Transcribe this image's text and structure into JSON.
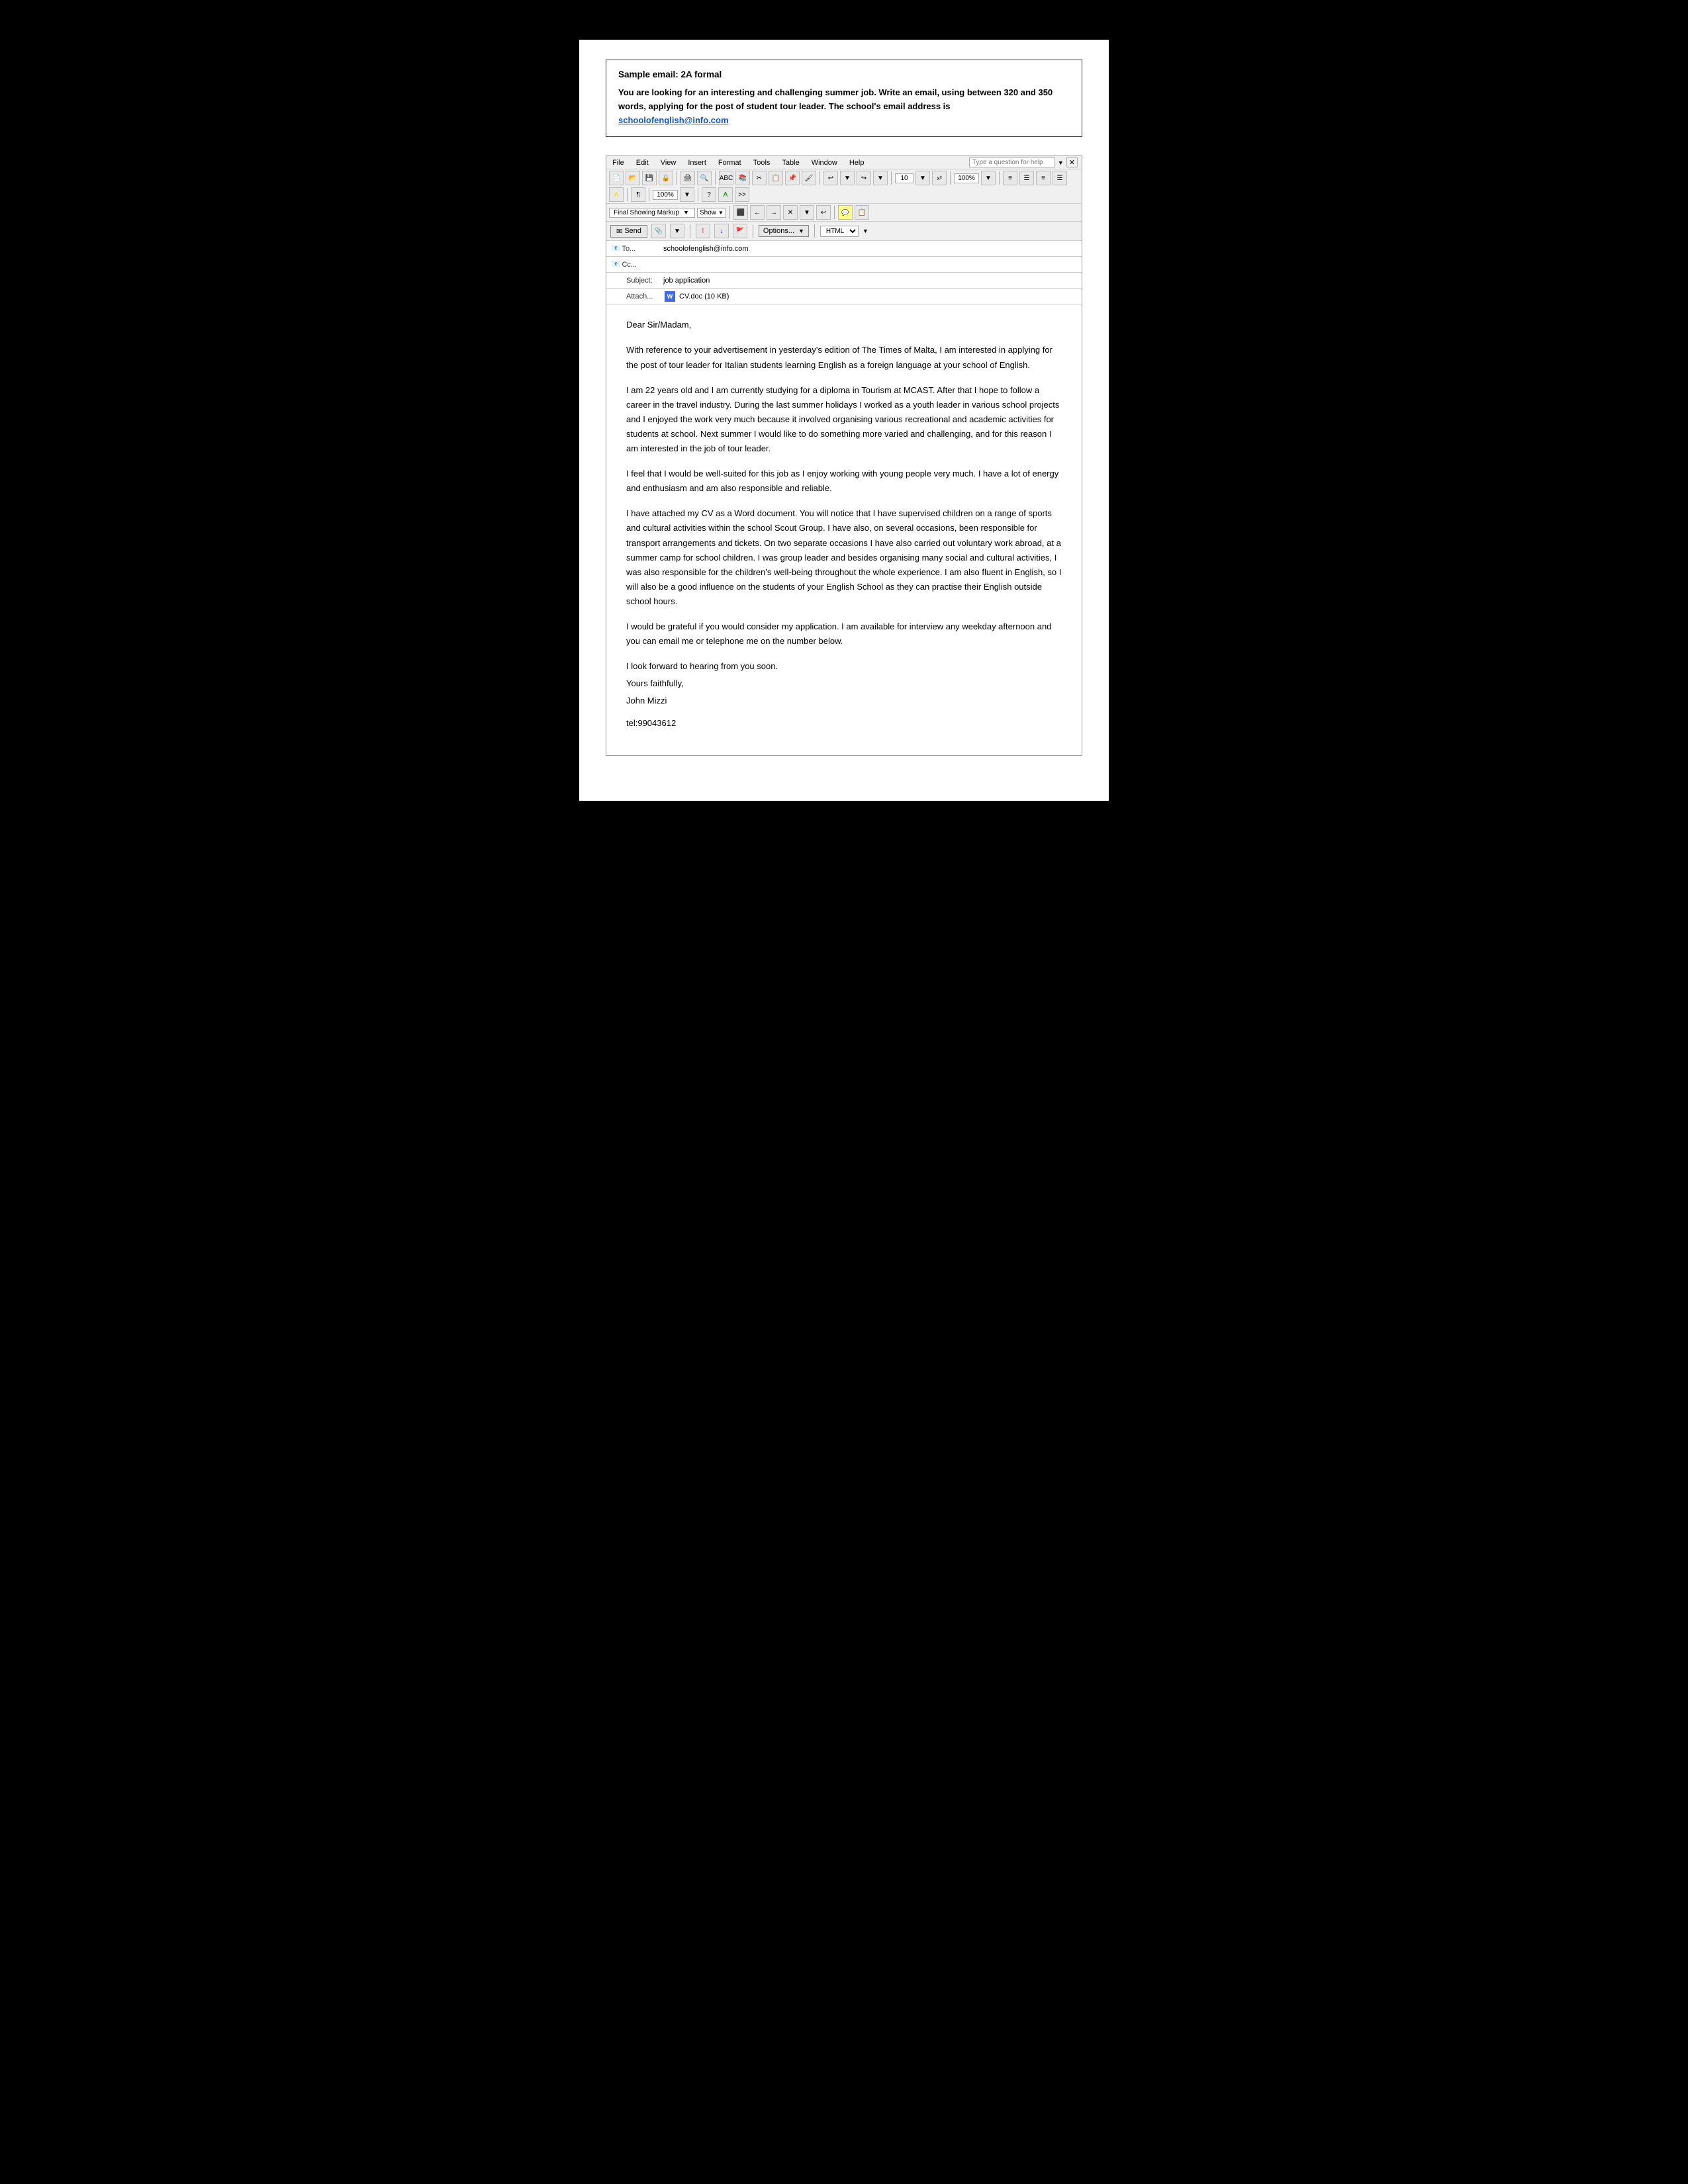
{
  "sample_box": {
    "title": "Sample email: 2A formal",
    "prompt": "You are looking for an interesting and challenging summer job.  Write an email, using between 320 and 350 words, applying for the post of student tour leader.  The school's email address is",
    "email_link": "schoolofenglish@info.com",
    "email_href": "mailto:schoolofenglish@info.com"
  },
  "email_client": {
    "menu": {
      "file": "File",
      "edit": "Edit",
      "view": "View",
      "insert": "Insert",
      "format": "Format",
      "tools": "Tools",
      "table": "Table",
      "window": "Window",
      "help": "Help"
    },
    "help_placeholder": "Type a question for help",
    "toolbar1": {
      "font_size": "10",
      "zoom": "100%",
      "zoom2": "100%"
    },
    "markup_dropdown": "Final Showing Markup",
    "show_dropdown": "Show",
    "send_label": "Send",
    "options_label": "Options...",
    "format_label": "HTML",
    "fields": {
      "to_label": "To...",
      "to_value": "schoolofenglish@info.com",
      "cc_label": "Cc...",
      "cc_value": "",
      "subject_label": "Subject:",
      "subject_value": "job application",
      "attach_label": "Attach...",
      "attach_file": "CV.doc (10 KB)"
    }
  },
  "email_body": {
    "salutation": "Dear Sir/Madam,",
    "para1": "With reference to your advertisement in yesterday's edition of The Times of Malta, I am interested in applying for the post of tour leader for Italian students learning English as a foreign language at your school of English.",
    "para2": "I am 22 years old and I am currently studying for a diploma in Tourism at  MCAST. After that I hope to follow a career in the travel industry. During the last summer holidays I worked as a youth leader in various school projects and I enjoyed the work very much because it involved organising various recreational and academic activities for students at school. Next summer I would like to do something more varied and challenging, and for this reason I am interested in the job of tour leader.",
    "para3": "I feel that I would be well-suited for this job as I enjoy working with young people very much. I have a lot of energy and enthusiasm and am also responsible and reliable.",
    "para4": "I have attached my CV as a Word document. You will notice that I have supervised children on a range of sports and cultural activities within the school Scout Group. I have also, on several occasions, been responsible for transport arrangements and tickets.  On two separate occasions I have also carried out voluntary work abroad, at a summer camp for school children.  I was group leader and besides organising many social and cultural activities, I was also responsible for the children’s well-being throughout the whole experience.  I am also fluent in English, so I will also be a good influence on the students of your English School as they can practise their English outside school hours.",
    "para5": "I would be grateful if you would consider my application. I am available for interview any weekday afternoon and you can email me or telephone me on the number below.",
    "closing1": "I look forward to hearing from you soon.",
    "closing2": "Yours faithfully,",
    "closing3": "John Mizzi",
    "tel": "tel:99043612"
  }
}
